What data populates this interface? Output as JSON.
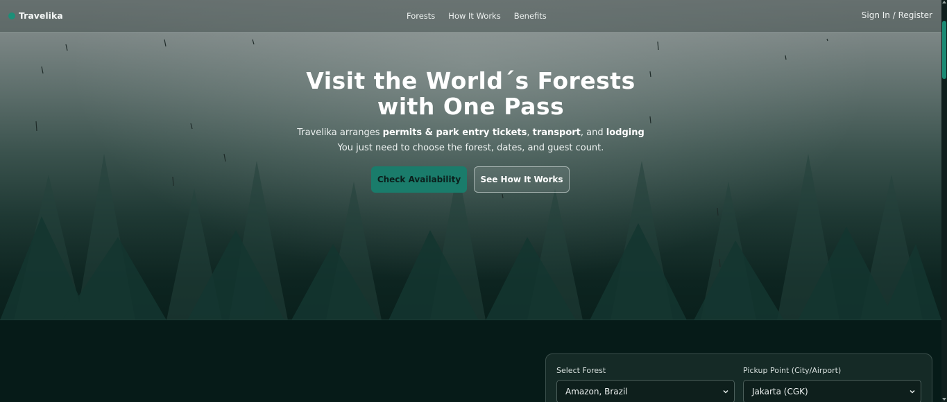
{
  "header": {
    "logo": "Travelika",
    "nav": [
      "Forests",
      "How It Works",
      "Benefits"
    ],
    "signin": "Sign In / Register"
  },
  "hero": {
    "title_line1": "Visit the World´s Forests",
    "title_line2": "with One Pass",
    "sub1": {
      "intro": "Travelika arranges ",
      "permits": "permits & park entry tickets",
      "sep1": ", ",
      "transport": "transport",
      "sep2": ", and ",
      "lodging": "lodging"
    },
    "sub2": "You just need to choose the forest, dates, and guest count.",
    "primary_button": "Check Availability",
    "secondary_button": "See How It Works"
  },
  "booking": {
    "forest_label": "Select Forest",
    "forest_value": "Amazon, Brazil",
    "pickup_label": "Pickup Point (City/Airport)",
    "pickup_value": "Jakarta (CGK)"
  },
  "colors": {
    "accent": "#1a7c6b",
    "background": "#061b18"
  },
  "icons": {
    "logo": "leaf-dot-icon",
    "select_chevron": "chevron-down-icon"
  }
}
